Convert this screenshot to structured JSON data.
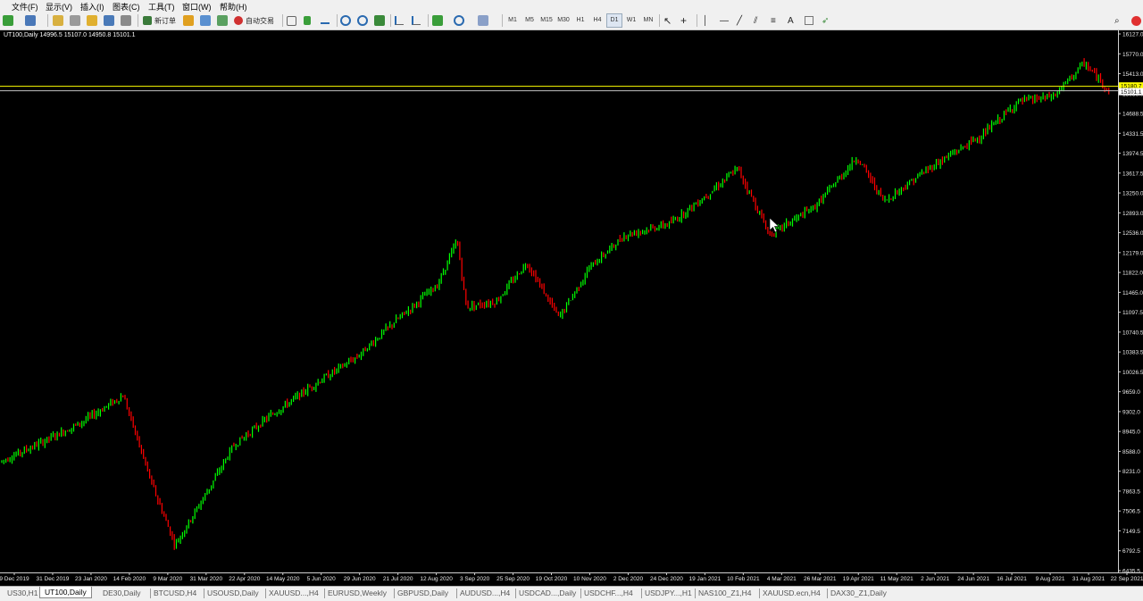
{
  "menu": [
    "文件(F)",
    "显示(V)",
    "插入(I)",
    "图表(C)",
    "工具(T)",
    "窗口(W)",
    "帮助(H)"
  ],
  "toolbar": {
    "new_order": "新订单",
    "auto_trading": "自动交易",
    "timeframes": [
      "M1",
      "M5",
      "M15",
      "M30",
      "H1",
      "H4",
      "D1",
      "W1",
      "MN"
    ],
    "text_tool": "A",
    "icons": [
      "new-chart-icon",
      "profiles-icon",
      "market-watch-icon",
      "data-window-icon",
      "navigator-icon",
      "terminal-icon",
      "strategy-tester-icon",
      "metaeditor-icon",
      "expert-advisors-icon",
      "bar-chart-icon",
      "candlestick-icon",
      "line-chart-icon",
      "zoom-in-icon",
      "zoom-out-icon",
      "tile-windows-icon",
      "autoscroll-icon",
      "chart-shift-icon",
      "indicators-icon",
      "periods-icon",
      "templates-icon",
      "cursor-icon",
      "crosshair-icon",
      "vertical-line-icon",
      "horizontal-line-icon",
      "trendline-icon",
      "channel-icon",
      "fibonacci-icon",
      "text-label-icon",
      "arrows-icon",
      "search-icon",
      "alert-icon"
    ]
  },
  "chart": {
    "title": "UT100,Daily  14996.5 15107.0 14950.8 15101.1",
    "colors": {
      "bull": "#00ff00",
      "bear": "#ff0000",
      "background": "#000000",
      "hline": "#ffff00",
      "bid_line": "#c0c0c0"
    },
    "current_price": "15101.1",
    "level_price": "15180.7",
    "price_labels": [
      "16127.0",
      "15770.0",
      "15413.0",
      "15056.0",
      "14688.5",
      "14331.5",
      "13974.5",
      "13617.5",
      "13250.0",
      "12893.0",
      "12536.0",
      "12179.0",
      "11822.0",
      "11465.0",
      "11097.5",
      "10740.5",
      "10383.5",
      "10026.5",
      "9659.0",
      "9302.0",
      "8945.0",
      "8588.0",
      "8231.0",
      "7863.5",
      "7506.5",
      "7149.5",
      "6792.5",
      "6435.5"
    ],
    "date_labels": [
      "9 Dec 2019",
      "31 Dec 2019",
      "23 Jan 2020",
      "14 Feb 2020",
      "9 Mar 2020",
      "31 Mar 2020",
      "22 Apr 2020",
      "14 May 2020",
      "5 Jun 2020",
      "29 Jun 2020",
      "21 Jul 2020",
      "12 Aug 2020",
      "3 Sep 2020",
      "25 Sep 2020",
      "19 Oct 2020",
      "10 Nov 2020",
      "2 Dec 2020",
      "24 Dec 2020",
      "19 Jan 2021",
      "10 Feb 2021",
      "4 Mar 2021",
      "26 Mar 2021",
      "19 Apr 2021",
      "11 May 2021",
      "2 Jun 2021",
      "24 Jun 2021",
      "16 Jul 2021",
      "9 Aug 2021",
      "31 Aug 2021",
      "22 Sep 2021"
    ]
  },
  "chart_data": {
    "type": "candlestick",
    "title": "UT100,Daily",
    "ylim": [
      6435.5,
      16127.0
    ],
    "series": [
      {
        "name": "UT100",
        "points": [
          {
            "x": "9 Dec 2019",
            "close": 8400
          },
          {
            "x": "31 Dec 2019",
            "close": 8700
          },
          {
            "x": "23 Jan 2020",
            "close": 9100
          },
          {
            "x": "14 Feb 2020",
            "close": 9600
          },
          {
            "x": "24 Feb 2020",
            "close": 9000
          },
          {
            "x": "9 Mar 2020",
            "close": 8000
          },
          {
            "x": "20 Mar 2020",
            "close": 6900
          },
          {
            "x": "31 Mar 2020",
            "close": 7700
          },
          {
            "x": "22 Apr 2020",
            "close": 8700
          },
          {
            "x": "14 May 2020",
            "close": 9200
          },
          {
            "x": "5 Jun 2020",
            "close": 9800
          },
          {
            "x": "29 Jun 2020",
            "close": 10300
          },
          {
            "x": "21 Jul 2020",
            "close": 10900
          },
          {
            "x": "12 Aug 2020",
            "close": 11600
          },
          {
            "x": "1 Sep 2020",
            "close": 12400
          },
          {
            "x": "8 Sep 2020",
            "close": 11200
          },
          {
            "x": "25 Sep 2020",
            "close": 11300
          },
          {
            "x": "12 Oct 2020",
            "close": 12000
          },
          {
            "x": "28 Oct 2020",
            "close": 11000
          },
          {
            "x": "10 Nov 2020",
            "close": 11900
          },
          {
            "x": "2 Dec 2020",
            "close": 12500
          },
          {
            "x": "24 Dec 2020",
            "close": 12700
          },
          {
            "x": "19 Jan 2021",
            "close": 13200
          },
          {
            "x": "10 Feb 2021",
            "close": 13700
          },
          {
            "x": "4 Mar 2021",
            "close": 12500
          },
          {
            "x": "26 Mar 2021",
            "close": 13000
          },
          {
            "x": "19 Apr 2021",
            "close": 13900
          },
          {
            "x": "11 May 2021",
            "close": 13100
          },
          {
            "x": "2 Jun 2021",
            "close": 13700
          },
          {
            "x": "24 Jun 2021",
            "close": 14300
          },
          {
            "x": "16 Jul 2021",
            "close": 14900
          },
          {
            "x": "9 Aug 2021",
            "close": 15000
          },
          {
            "x": "31 Aug 2021",
            "close": 15600
          },
          {
            "x": "20 Sep 2021",
            "close": 15101.1
          }
        ]
      }
    ]
  },
  "tabs": {
    "labels": [
      "US30,H1",
      "UT100,Daily",
      "DE30,Daily",
      "BTCUSD,H4",
      "USOUSD,Daily",
      "XAUUSD...,H4",
      "EURUSD,Weekly",
      "GBPUSD,Daily",
      "AUDUSD...,H4",
      "USDCAD...,Daily",
      "USDCHF...,H4",
      "USDJPY...,H1",
      "NAS100_Z1,H4",
      "XAUUSD.ecn,H4",
      "DAX30_Z1,Daily"
    ],
    "active_index": 1
  }
}
